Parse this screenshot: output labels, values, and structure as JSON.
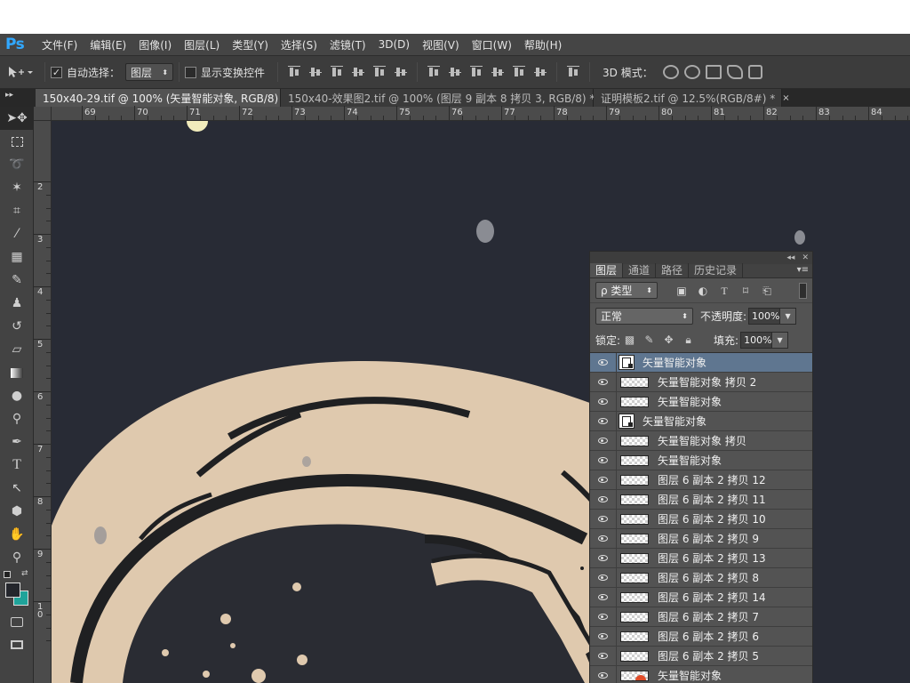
{
  "app": {
    "logo": "Ps"
  },
  "menu": [
    "文件(F)",
    "编辑(E)",
    "图像(I)",
    "图层(L)",
    "类型(Y)",
    "选择(S)",
    "滤镜(T)",
    "3D(D)",
    "视图(V)",
    "窗口(W)",
    "帮助(H)"
  ],
  "options": {
    "auto_select_label": "自动选择：",
    "auto_select_checked": "✓",
    "auto_select_value": "图层",
    "show_transform_label": "显示变换控件",
    "mode_3d_label": "3D 模式："
  },
  "tabs": [
    {
      "label": "150x40-29.tif @ 100% (矢量智能对象, RGB/8)",
      "close": "×",
      "active": true
    },
    {
      "label": "150x40-效果图2.tif @ 100% (图层 9 副本 8 拷贝 3, RGB/8) *",
      "close": "×",
      "active": false
    },
    {
      "label": "证明模板2.tif @ 12.5%(RGB/8#) *",
      "close": "×",
      "active": false
    }
  ],
  "ruler_top_labels": [
    "69",
    "70",
    "71",
    "72",
    "73",
    "74",
    "75",
    "76",
    "77",
    "78",
    "79",
    "80",
    "81",
    "82",
    "83",
    "84"
  ],
  "ruler_left_labels": [
    "2",
    "3",
    "4",
    "5",
    "6",
    "7",
    "8",
    "9",
    "1 0"
  ],
  "layers_panel": {
    "tabs": [
      "图层",
      "通道",
      "路径",
      "历史记录"
    ],
    "filter_label": "ρ 类型",
    "blend_mode": "正常",
    "opacity_label": "不透明度:",
    "opacity_value": "100%",
    "lock_label": "锁定:",
    "fill_label": "填充:",
    "fill_value": "100%",
    "layers": [
      {
        "name": "矢量智能对象",
        "kind": "smart",
        "selected": true
      },
      {
        "name": "矢量智能对象 拷贝 2",
        "kind": "raster"
      },
      {
        "name": "矢量智能对象",
        "kind": "raster"
      },
      {
        "name": "矢量智能对象",
        "kind": "smart"
      },
      {
        "name": "矢量智能对象 拷贝",
        "kind": "raster"
      },
      {
        "name": "矢量智能对象",
        "kind": "raster"
      },
      {
        "name": "图层 6 副本 2 拷贝 12",
        "kind": "raster"
      },
      {
        "name": "图层 6 副本 2 拷贝 11",
        "kind": "raster"
      },
      {
        "name": "图层 6 副本 2 拷贝 10",
        "kind": "raster"
      },
      {
        "name": "图层 6 副本 2 拷贝 9",
        "kind": "raster"
      },
      {
        "name": "图层 6 副本 2 拷贝 13",
        "kind": "raster"
      },
      {
        "name": "图层 6 副本 2 拷贝 8",
        "kind": "raster"
      },
      {
        "name": "图层 6 副本 2 拷贝 14",
        "kind": "raster"
      },
      {
        "name": "图层 6 副本 2 拷贝 7",
        "kind": "raster"
      },
      {
        "name": "图层 6 副本 2 拷贝 6",
        "kind": "raster"
      },
      {
        "name": "图层 6 副本 2 拷贝 5",
        "kind": "raster"
      },
      {
        "name": "矢量智能对象",
        "kind": "raster-red"
      }
    ]
  },
  "colors": {
    "canvas_bg": "#282b35",
    "helmet": "#dfc9ae",
    "outline": "#1f2022",
    "visor": "#2a2c33",
    "selection": "#5f7690",
    "background_swatch": "#1fa39a"
  }
}
